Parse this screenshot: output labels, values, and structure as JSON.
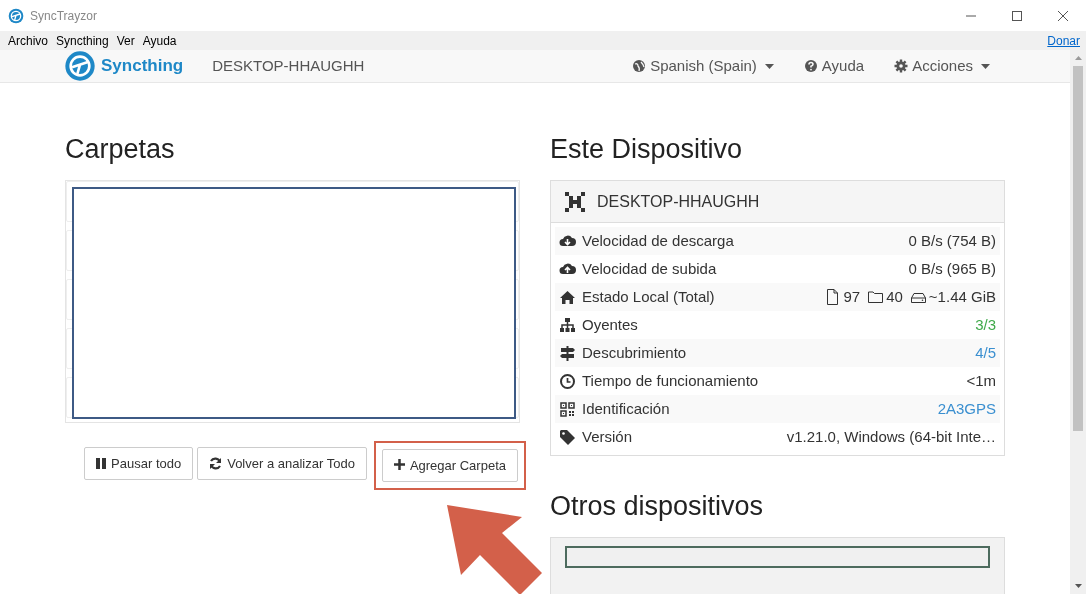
{
  "window": {
    "title": "SyncTrayzor"
  },
  "menu": [
    "Archivo",
    "Syncthing",
    "Ver",
    "Ayuda"
  ],
  "donate_link": "Donar",
  "navbar": {
    "brand": "Syncthing",
    "device_name": "DESKTOP-HHAUGHH",
    "items": [
      {
        "label": "Spanish (Spain)",
        "dropdown": true
      },
      {
        "label": "Ayuda",
        "dropdown": false
      },
      {
        "label": "Acciones",
        "dropdown": true
      }
    ]
  },
  "folders": {
    "title": "Carpetas",
    "buttons": [
      "Pausar todo",
      "Volver a analizar Todo",
      "Agregar Carpeta"
    ]
  },
  "this_device": {
    "title": "Este Dispositivo",
    "name": "DESKTOP-HHAUGHH",
    "rows": [
      {
        "label": "Velocidad de descarga",
        "value": "0 B/s (754 B)",
        "color": "#333333"
      },
      {
        "label": "Velocidad de subida",
        "value": "0 B/s (965 B)",
        "color": "#333333"
      },
      {
        "label": "Estado Local (Total)",
        "parts": [
          "97",
          "40",
          "~1.44 GiB"
        ],
        "color": "#333333"
      },
      {
        "label": "Oyentes",
        "value": "3/3",
        "color": "#3fa94a"
      },
      {
        "label": "Descubrimiento",
        "value": "4/5",
        "color": "#3a8fd0"
      },
      {
        "label": "Tiempo de funcionamiento",
        "value": "<1m",
        "color": "#333333"
      },
      {
        "label": "Identificación",
        "value": "2A3GPS",
        "color": "#3a8fd0"
      },
      {
        "label": "Versión",
        "value": "v1.21.0, Windows (64-bit Inte…",
        "color": "#333333"
      }
    ]
  },
  "other_devices": {
    "title": "Otros dispositivos"
  }
}
